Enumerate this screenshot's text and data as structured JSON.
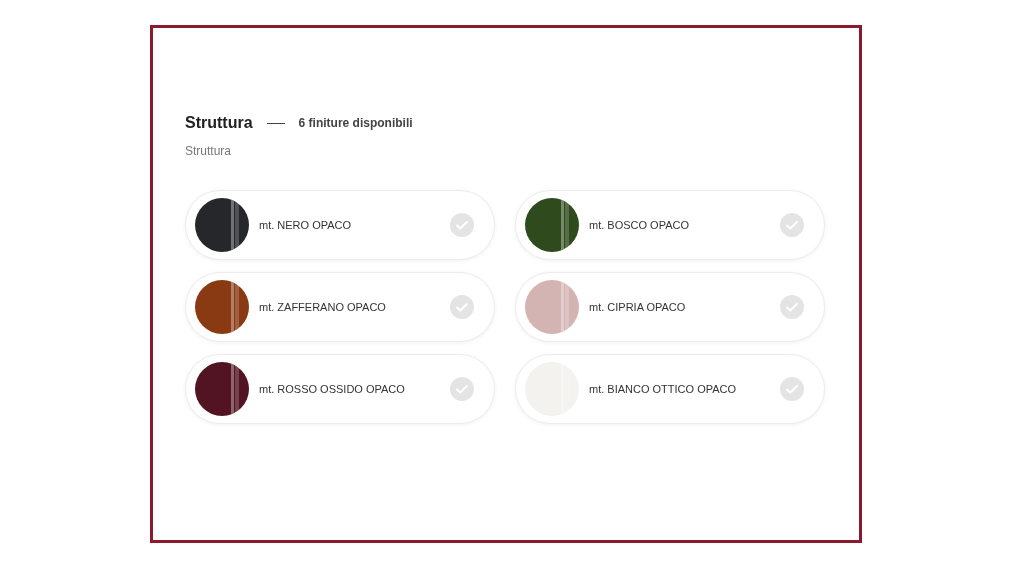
{
  "section": {
    "title": "Struttura",
    "count": "6 finiture disponibili",
    "subtitle": "Struttura"
  },
  "finishes": [
    {
      "name": "mt. NERO OPACO",
      "color": "#26272a",
      "selected": false
    },
    {
      "name": "mt. BOSCO OPACO",
      "color": "#2f4a1c",
      "selected": false
    },
    {
      "name": "mt. ZAFFERANO OPACO",
      "color": "#8a3a12",
      "selected": false
    },
    {
      "name": "mt. CIPRIA OPACO",
      "color": "#d4b3b3",
      "selected": false
    },
    {
      "name": "mt. ROSSO OSSIDO OPACO",
      "color": "#521422",
      "selected": false
    },
    {
      "name": "mt. BIANCO OTTICO OPACO",
      "color": "#f3f2ee",
      "selected": false
    }
  ]
}
